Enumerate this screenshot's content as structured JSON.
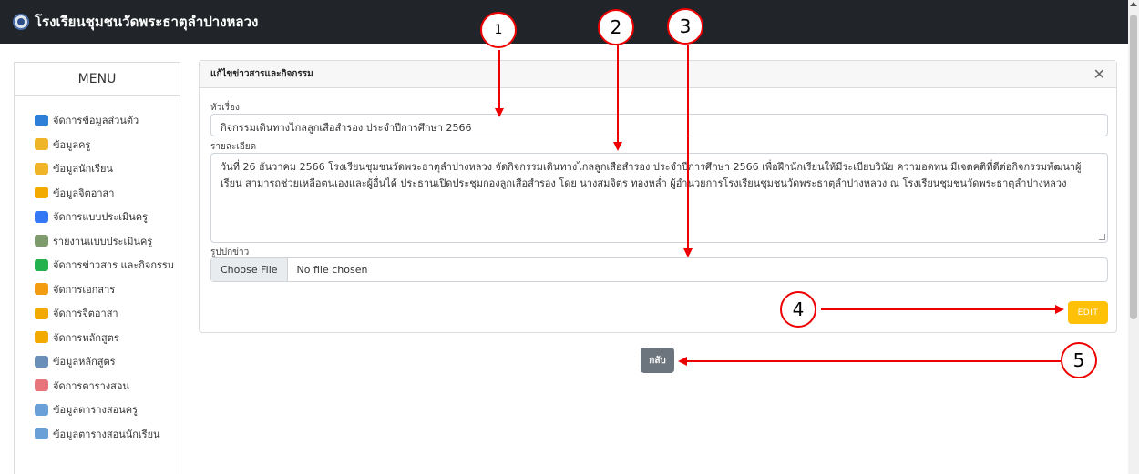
{
  "header": {
    "title": "โรงเรียนชุมชนวัดพระธาตุลำปางหลวง"
  },
  "menu": {
    "heading": "MENU",
    "items": [
      {
        "label": "จัดการข้อมูลส่วนตัว",
        "icon": "id-card-icon",
        "color": "#2f7fd8"
      },
      {
        "label": "ข้อมูลครู",
        "icon": "teacher-icon",
        "color": "#f0b429"
      },
      {
        "label": "ข้อมูลนักเรียน",
        "icon": "student-icon",
        "color": "#f0b429"
      },
      {
        "label": "ข้อมูลจิตอาสา",
        "icon": "star-icon",
        "color": "#f2a900"
      },
      {
        "label": "จัดการแบบประเมินครู",
        "icon": "form-icon",
        "color": "#3478f6"
      },
      {
        "label": "รายงานแบบประเมินครู",
        "icon": "report-icon",
        "color": "#7d9b6b"
      },
      {
        "label": "จัดการข่าวสาร และกิจกรรม",
        "icon": "chat-icon",
        "color": "#22b14c"
      },
      {
        "label": "จัดการเอกสาร",
        "icon": "folder-icon",
        "color": "#f39c12"
      },
      {
        "label": "จัดการจิตอาสา",
        "icon": "star-icon",
        "color": "#f2a900"
      },
      {
        "label": "จัดการหลักสูตร",
        "icon": "star-icon",
        "color": "#f2a900"
      },
      {
        "label": "ข้อมูลหลักสูตร",
        "icon": "course-icon",
        "color": "#6a8fb8"
      },
      {
        "label": "จัดการตารางสอน",
        "icon": "calendar-icon",
        "color": "#e8747c"
      },
      {
        "label": "ข้อมูลตารางสอนครู",
        "icon": "timetable-icon",
        "color": "#6aa0d8"
      },
      {
        "label": "ข้อมูลตารางสอนนักเรียน",
        "icon": "timetable-icon",
        "color": "#6aa0d8"
      }
    ]
  },
  "card": {
    "title": "แก้ไขข่าวสารและกิจกรรม",
    "close_symbol": "✕",
    "subject_label": "หัวเรื่อง",
    "subject_value": "กิจกรรมเดินทางไกลลูกเสือสำรอง ประจำปีการศึกษา 2566",
    "detail_label": "รายละเอียด",
    "detail_value": "วันที่ 26 ธันวาคม 2566 โรงเรียนชุมชนวัดพระธาตุลำปางหลวง จัดกิจกรรมเดินทางไกลลูกเสือสำรอง ประจำปีการศึกษา 2566 เพื่อฝึกนักเรียนให้มีระเบียบวินัย ความอดทน มีเจตคติที่ดีต่อกิจกรรมพัฒนาผู้เรียน สามารถช่วยเหลือตนเองและผู้อื่นได้ ประธานเปิดประชุมกองลูกเสือสำรอง โดย นางสมจิตร ทองหล่ำ ผู้อำนวยการโรงเรียนชุมชนวัดพระธาตุลำปางหลวง ณ โรงเรียนชุมชนวัดพระธาตุลำปางหลวง",
    "image_label": "รูปปกข่าว",
    "choose_file": "Choose File",
    "no_file": "No file chosen",
    "edit_label": "EDIT"
  },
  "back_label": "กลับ",
  "callouts": {
    "c1": "1",
    "c2": "2",
    "c3": "3",
    "c4": "4",
    "c5": "5"
  },
  "colors": {
    "topbar": "#212529",
    "edit": "#ffc107",
    "back": "#6c757d",
    "callout": "#e00000"
  }
}
